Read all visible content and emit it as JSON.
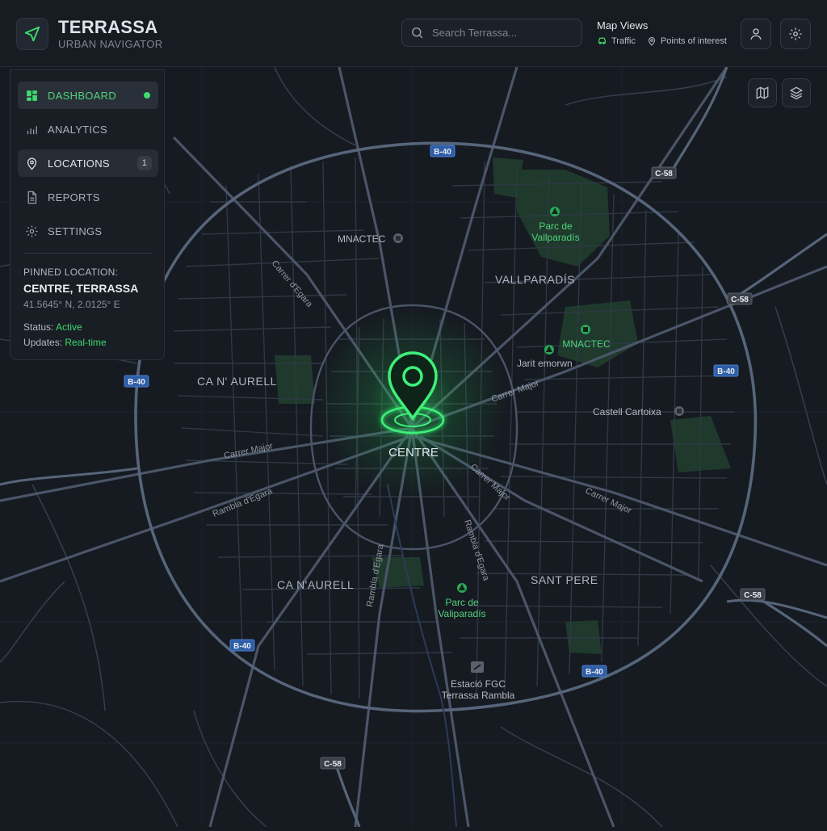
{
  "header": {
    "title": "TERRASSA",
    "subtitle": "URBAN NAVIGATOR",
    "search_placeholder": "Search Terrassa...",
    "map_views": {
      "title": "Map Views",
      "traffic_label": "Traffic",
      "poi_label": "Points of interest"
    },
    "icons": [
      "navigation-arrow-icon",
      "search-icon",
      "car-icon",
      "map-pin-icon",
      "user-icon",
      "gear-icon"
    ]
  },
  "sidebar": {
    "items": [
      {
        "label": "DASHBOARD",
        "icon": "dashboard-grid-icon",
        "active": true
      },
      {
        "label": "ANALYTICS",
        "icon": "bar-chart-icon"
      },
      {
        "label": "LOCATIONS",
        "icon": "map-pin-icon",
        "badge": "1"
      },
      {
        "label": "REPORTS",
        "icon": "document-icon"
      },
      {
        "label": "SETTINGS",
        "icon": "gear-icon"
      }
    ],
    "pinned": {
      "label": "PINNED LOCATION:",
      "name": "CENTRE, TERRASSA",
      "coords": "41.5645° N, 2.0125° E",
      "status_label": "Status:",
      "status_value": "Active",
      "updates_label": "Updates:",
      "updates_value": "Real-time"
    }
  },
  "map": {
    "controls": [
      "map-view-icon",
      "layers-icon"
    ],
    "center_label": "CENTRE",
    "districts": {
      "ca_n_aurell_north": "CA N' AURELL",
      "ca_n_aurell_south": "CA N'AURELL",
      "vallparadis": "VALLPARADÍS",
      "sant_pere": "SANT PERE"
    },
    "road_shields": {
      "b40_top": "B-40",
      "b40_left": "B-40",
      "b40_right": "B-40",
      "b40_bottom_left": "B-40",
      "b40_bottom_right": "B-40",
      "c58_top": "C-58",
      "c58_right": "C-58",
      "c58_right_lower": "C-58",
      "c58_bottom": "C-58"
    },
    "streets": {
      "egara_nw": "Carrer d'Egara",
      "major_w": "Carrer Major",
      "rambla_w": "Rambla d'Egara",
      "major_ne": "Carrer Major",
      "major_se1": "Carrer Major",
      "major_se2": "Carrer Major",
      "rambla_s": "Rambla d'Egara",
      "rambla_se": "Rambla d'Egara"
    },
    "pois": {
      "parc_north_1": "Parc de",
      "parc_north_2": "Vallparadís",
      "mnactec_1": "MNACTEC",
      "mnactec_2": "MNACTEC",
      "jardi": "Jarit emorwn",
      "castell": "Castell Cartoixa",
      "parc_south_1": "Parc de",
      "parc_south_2": "Valiparadís",
      "estacio_1": "Estació FGC",
      "estacio_2": "Terrassa Rambla"
    },
    "colors": {
      "background": "#161a21",
      "road": "#4a5568",
      "ring": "#566579",
      "accent": "#3ddc6e",
      "park": "#1f3a2c"
    }
  }
}
